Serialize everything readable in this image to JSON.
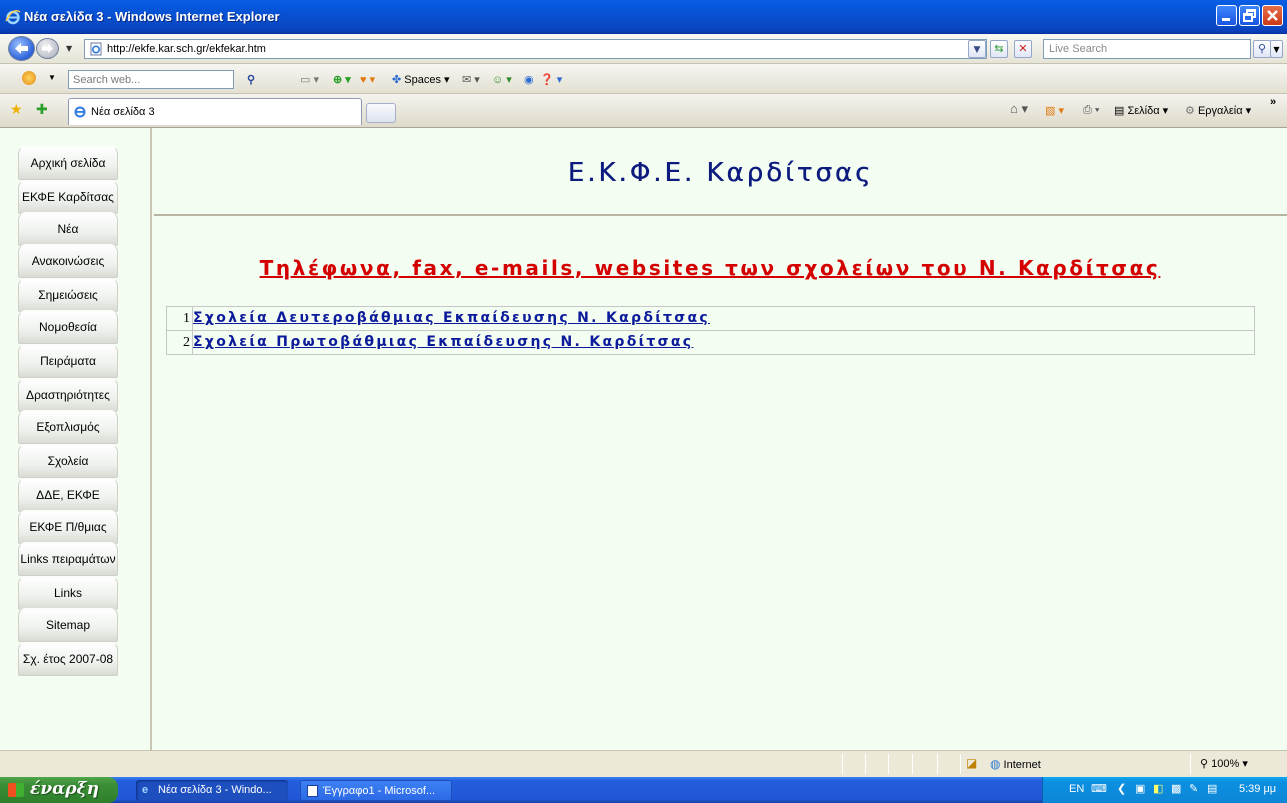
{
  "window": {
    "title": "Νέα σελίδα 3 - Windows Internet Explorer"
  },
  "address": {
    "url": "http://ekfe.kar.sch.gr/ekfekar.htm",
    "search_placeholder": "Live Search"
  },
  "toolbar": {
    "search_placeholder": "Search web...",
    "spaces_label": "Spaces"
  },
  "tab": {
    "label": "Νέα σελίδα 3"
  },
  "commands": {
    "page_label": "Σελίδα",
    "tools_label": "Εργαλεία"
  },
  "site": {
    "heading": "Ε.Κ.Φ.Ε. Καρδίτσας",
    "main_title": "Τηλέφωνα, fax, e-mails, websites των σχολείων του Ν. Καρδίτσας",
    "links": [
      {
        "num": "1",
        "label": "Σχολεία Δευτεροβάθμιας Εκπαίδευσης Ν. Καρδίτσας"
      },
      {
        "num": "2",
        "label": "Σχολεία Πρωτοβάθμιας Εκπαίδευσης Ν. Καρδίτσας"
      }
    ]
  },
  "sidebar": {
    "items": [
      {
        "label": "Αρχική σελίδα"
      },
      {
        "label": "ΕΚΦΕ Καρδίτσας"
      },
      {
        "label": "Νέα"
      },
      {
        "label": "Ανακοινώσεις"
      },
      {
        "label": "Σημειώσεις"
      },
      {
        "label": "Νομοθεσία"
      },
      {
        "label": "Πειράματα"
      },
      {
        "label": "Δραστηριότητες"
      },
      {
        "label": "Εξοπλισμός"
      },
      {
        "label": "Σχολεία"
      },
      {
        "label": "ΔΔΕ, ΕΚΦΕ"
      },
      {
        "label": "ΕΚΦΕ Π/θμιας"
      },
      {
        "label": "Links πειραμάτων"
      },
      {
        "label": "Links"
      },
      {
        "label": "Sitemap"
      },
      {
        "label": "Σχ. έτος 2007-08"
      }
    ]
  },
  "status": {
    "zone": "Internet",
    "zoom": "100%"
  },
  "taskbar": {
    "start_label": "έναρξη",
    "tasks": [
      {
        "label": "Νέα σελίδα 3 - Windo..."
      },
      {
        "label": "Έγγραφο1 - Microsof..."
      }
    ],
    "lang": "EN",
    "clock": "5:39 μμ"
  },
  "colors": {
    "heading": "#0c1b7d",
    "title_red": "#d40000",
    "link": "#0c1b9b",
    "page_bg": "#f3fdf2"
  }
}
